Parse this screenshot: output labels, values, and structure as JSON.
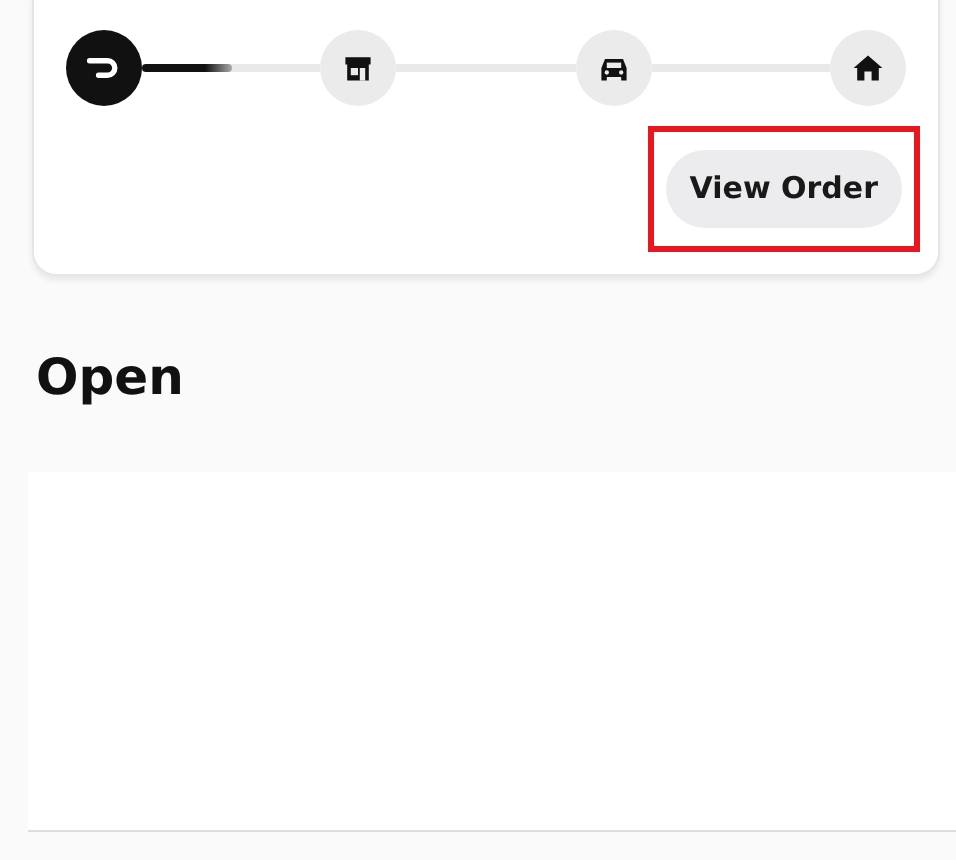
{
  "progress": {
    "segments": [
      {
        "level": 0.5
      }
    ],
    "steps": [
      {
        "kind": "courier",
        "active": true
      },
      {
        "kind": "store",
        "active": false
      },
      {
        "kind": "car",
        "active": false
      },
      {
        "kind": "home",
        "active": false
      }
    ]
  },
  "view_order_button": {
    "label": "View Order",
    "highlighted": true
  },
  "section_title": "Open"
}
